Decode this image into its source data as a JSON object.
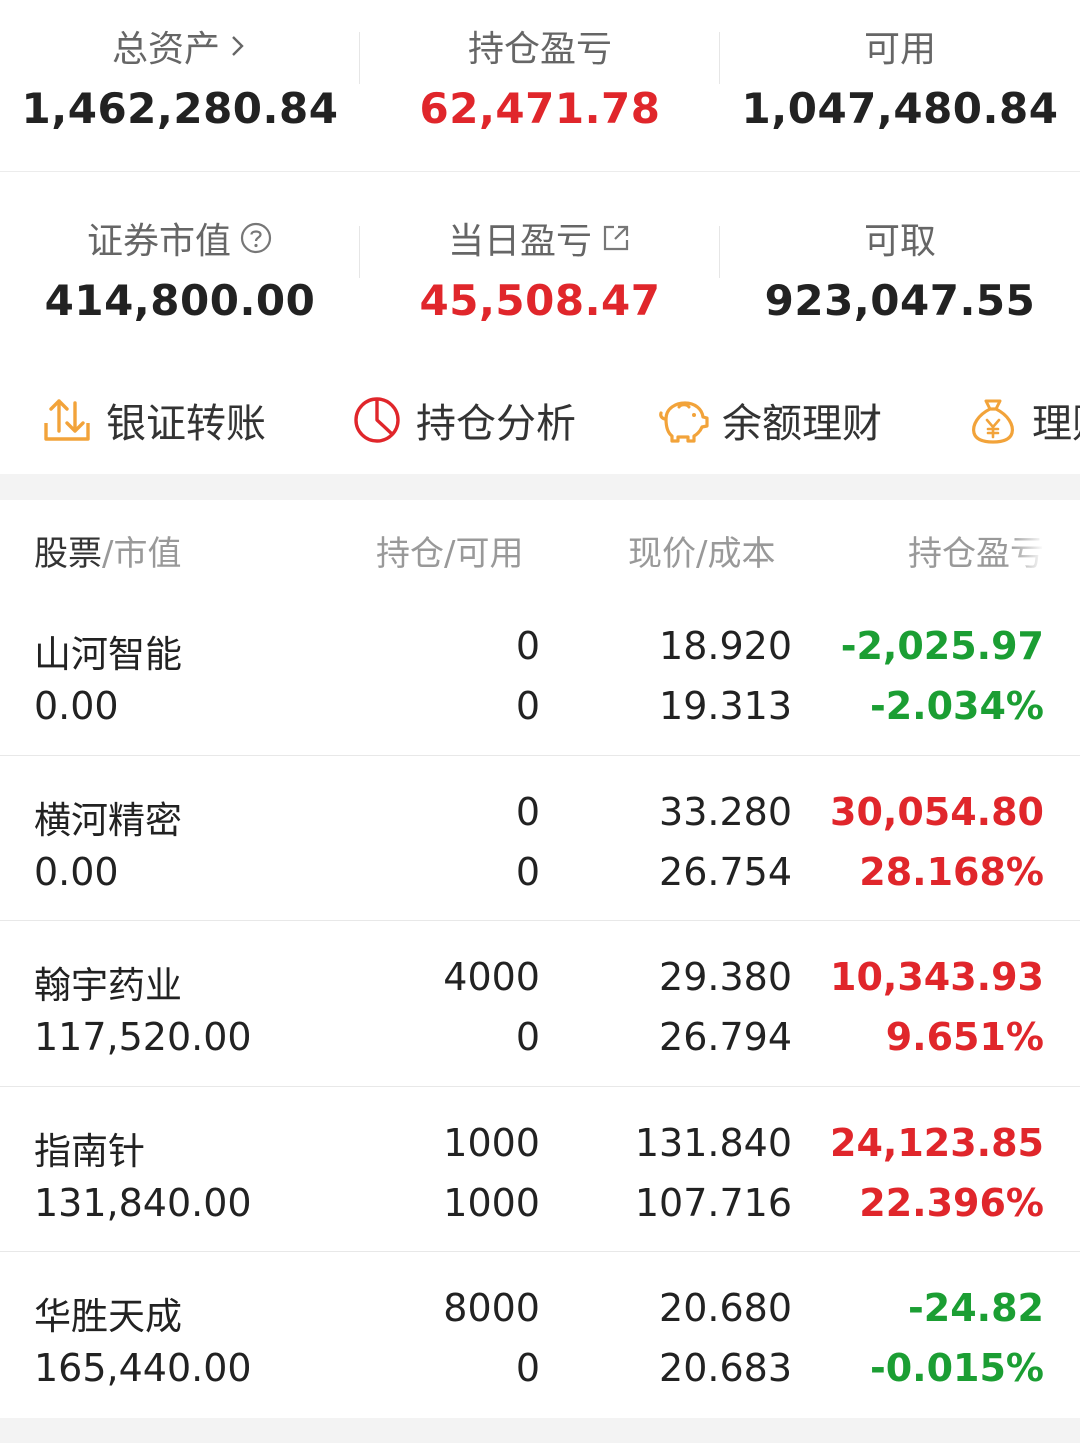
{
  "summary": {
    "total_assets_label": "总资产",
    "total_assets_value": "1,462,280.84",
    "position_pl_label": "持仓盈亏",
    "position_pl_value": "62,471.78",
    "available_label": "可用",
    "available_value": "1,047,480.84",
    "securities_value_label": "证券市值",
    "securities_value_value": "414,800.00",
    "daily_pl_label": "当日盈亏",
    "daily_pl_value": "45,508.47",
    "withdrawable_label": "可取",
    "withdrawable_value": "923,047.55"
  },
  "toolbar": {
    "transfer_label": "银证转账",
    "analysis_label": "持仓分析",
    "balance_label": "余额理财",
    "finance_label": "理财"
  },
  "table": {
    "header": {
      "stock": "股票",
      "market_value": "市值",
      "position": "持仓",
      "available": "可用",
      "price": "现价",
      "cost": "成本",
      "pl": "持仓盈亏",
      "sep": "/"
    },
    "rows": [
      {
        "name": "山河智能",
        "market_value": "0.00",
        "position": "0",
        "available": "0",
        "price": "18.920",
        "cost": "19.313",
        "pl": "-2,025.97",
        "pl_pct": "-2.034%",
        "trend": "down"
      },
      {
        "name": "横河精密",
        "market_value": "0.00",
        "position": "0",
        "available": "0",
        "price": "33.280",
        "cost": "26.754",
        "pl": "30,054.80",
        "pl_pct": "28.168%",
        "trend": "up"
      },
      {
        "name": "翰宇药业",
        "market_value": "117,520.00",
        "position": "4000",
        "available": "0",
        "price": "29.380",
        "cost": "26.794",
        "pl": "10,343.93",
        "pl_pct": "9.651%",
        "trend": "up"
      },
      {
        "name": "指南针",
        "market_value": "131,840.00",
        "position": "1000",
        "available": "1000",
        "price": "131.840",
        "cost": "107.716",
        "pl": "24,123.85",
        "pl_pct": "22.396%",
        "trend": "up"
      },
      {
        "name": "华胜天成",
        "market_value": "165,440.00",
        "position": "8000",
        "available": "0",
        "price": "20.680",
        "cost": "20.683",
        "pl": "-24.82",
        "pl_pct": "-0.015%",
        "trend": "down"
      }
    ]
  },
  "colors": {
    "up": "#e0262b",
    "down": "#1b9e33",
    "icon_orange": "#f2a33a",
    "icon_red": "#e0262b"
  }
}
